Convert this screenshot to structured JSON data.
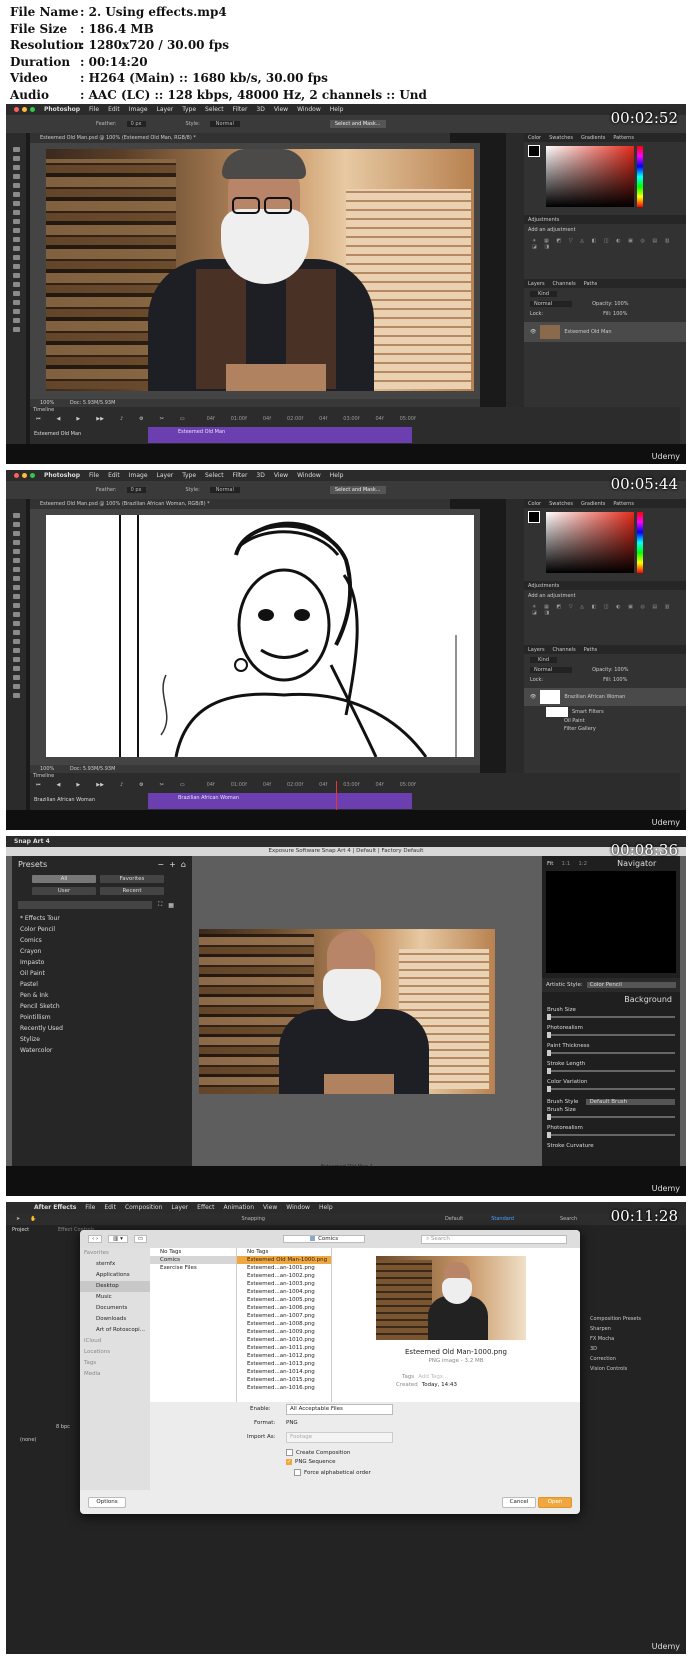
{
  "meta": {
    "rows": [
      {
        "key": "File Name",
        "value": ":  2. Using effects.mp4"
      },
      {
        "key": "File Size",
        "value": ":  186.4 MB"
      },
      {
        "key": "Resolution",
        "value": ":  1280x720 / 30.00 fps"
      },
      {
        "key": "Duration",
        "value": ":  00:14:20"
      },
      {
        "key": "Video",
        "value": ":  H264 (Main) :: 1680 kb/s, 30.00 fps"
      },
      {
        "key": "Audio",
        "value": ":  AAC (LC) :: 128 kbps, 48000 Hz, 2 channels :: Und"
      }
    ]
  },
  "brand": "Udemy",
  "frames": [
    {
      "timestamp": "00:02:52"
    },
    {
      "timestamp": "00:05:44"
    },
    {
      "timestamp": "00:08:36"
    },
    {
      "timestamp": "00:11:28"
    }
  ],
  "photoshop": {
    "app": "Photoshop",
    "menu": [
      "File",
      "Edit",
      "Image",
      "Layer",
      "Type",
      "Select",
      "Filter",
      "3D",
      "View",
      "Window",
      "Help"
    ],
    "options": {
      "feather": "Feather:",
      "feather_value": "0 px",
      "style": "Style:",
      "style_value": "Normal",
      "select_mask": "Select and Mask..."
    },
    "panel_tabs": [
      "Color",
      "Swatches",
      "Gradients",
      "Patterns"
    ],
    "adjustments": {
      "title": "Adjustments",
      "add": "Add an adjustment"
    },
    "layers_tabs": [
      "Layers",
      "Channels",
      "Paths"
    ],
    "kind": "Kind",
    "blend": "Normal",
    "opacity": "Opacity: 100%",
    "fill": "Fill: 100%",
    "lock": "Lock:",
    "timeline_label": "Timeline",
    "zoom": "100%",
    "doc": "Doc: 5.93M/5.93M",
    "ticks": [
      "04f",
      "01:00f",
      "04f",
      "02:00f",
      "04f",
      "03:00f",
      "04f",
      "05:00f"
    ],
    "frame1": {
      "doc_tab": "Esteemed Old Man.psd @ 100% (Esteemed Old Man, RGB/8) *",
      "layer": "Esteemed Old Man",
      "track": "Esteemed Old Man",
      "clip": "Esteemed Old Man"
    },
    "frame2": {
      "doc_tab": "Esteemed Old Man.psd @ 100% (Brazilian African Woman, RGB/8) *",
      "layer": "Brazilian African Woman",
      "smart_filters": "Smart Filters",
      "filter1": "Oil Paint",
      "filter2": "Filter Gallery",
      "track": "Brazilian African Woman",
      "clip": "Brazilian African Woman"
    }
  },
  "snapart": {
    "app": "Snap Art 4",
    "title": "Exposure Software Snap Art 4 | Default | Factory Default",
    "presets": "Presets",
    "buttons": [
      "All",
      "Favorites",
      "User",
      "Recent"
    ],
    "items": [
      "* Effects Tour",
      "Color Pencil",
      "Comics",
      "Crayon",
      "Impasto",
      "Oil Paint",
      "Pastel",
      "Pen & Ink",
      "Pencil Sketch",
      "Pointillism",
      "Recently Used",
      "Stylize",
      "Watercolor"
    ],
    "nav": {
      "fit": "Fit",
      "one": "1:1",
      "two": "1:2",
      "title": "Navigator"
    },
    "artistic_style": "Artistic Style:",
    "style_value": "Color Pencil",
    "background": "Background",
    "sliders": [
      "Brush Size",
      "Photorealism",
      "Paint Thickness",
      "Stroke Length",
      "Color Variation"
    ],
    "brush_style": "Brush Style",
    "brush_value": "Default Brush",
    "sliders2": [
      "Brush Size",
      "Photorealism",
      "Stroke Curvature"
    ],
    "caption": "Esteemed Old Man-1"
  },
  "aftereffects": {
    "app": "After Effects",
    "menu": [
      "File",
      "Edit",
      "Composition",
      "Layer",
      "Effect",
      "Animation",
      "View",
      "Window",
      "Help"
    ],
    "snapping": "Snapping",
    "workspace": [
      "Default",
      "Standard"
    ],
    "search_help": "Search",
    "project": "Project",
    "location": "Comics",
    "search": "Search",
    "favorites_label": "Favorites",
    "favorites": [
      "sternfx",
      "Applications",
      "Desktop",
      "Music",
      "Documents",
      "Downloads",
      "Art of Rotoscopi..."
    ],
    "other_labels": [
      "iCloud",
      "Locations",
      "Tags",
      "Media"
    ],
    "col1": [
      "No Tags",
      "Comics",
      "Exercise Files"
    ],
    "col2": [
      "No Tags",
      "Esteemed Old Man-1000.png",
      "Esteemed...an-1001.png",
      "Esteemed...an-1002.png",
      "Esteemed...an-1003.png",
      "Esteemed...an-1004.png",
      "Esteemed...an-1005.png",
      "Esteemed...an-1006.png",
      "Esteemed...an-1007.png",
      "Esteemed...an-1008.png",
      "Esteemed...an-1009.png",
      "Esteemed...an-1010.png",
      "Esteemed...an-1011.png",
      "Esteemed...an-1012.png",
      "Esteemed...an-1013.png",
      "Esteemed...an-1014.png",
      "Esteemed...an-1015.png",
      "Esteemed...an-1016.png"
    ],
    "preview_name": "Esteemed Old Man-1000.png",
    "preview_type": "PNG image - 3.2 MB",
    "tags_label": "Tags",
    "tags_placeholder": "Add Tags...",
    "created_label": "Created",
    "created_value": "Today, 14:43",
    "enable": "Enable:",
    "enable_value": "All Acceptable Files",
    "format": "Format:",
    "format_value": "PNG",
    "import_as": "Import As:",
    "import_value": "Footage",
    "checks": [
      {
        "label": "Create Composition",
        "checked": false
      },
      {
        "label": "PNG Sequence",
        "checked": true
      },
      {
        "label": "Force alphabetical order",
        "checked": false
      }
    ],
    "options_btn": "Options",
    "cancel": "Cancel",
    "open": "Open",
    "bg_items": [
      "Effect Controls",
      "Composition Presets",
      "Sharpen",
      "FX Mocha",
      "3D",
      "Correction",
      "Vision Controls",
      "(none)",
      "8 bpc"
    ]
  }
}
